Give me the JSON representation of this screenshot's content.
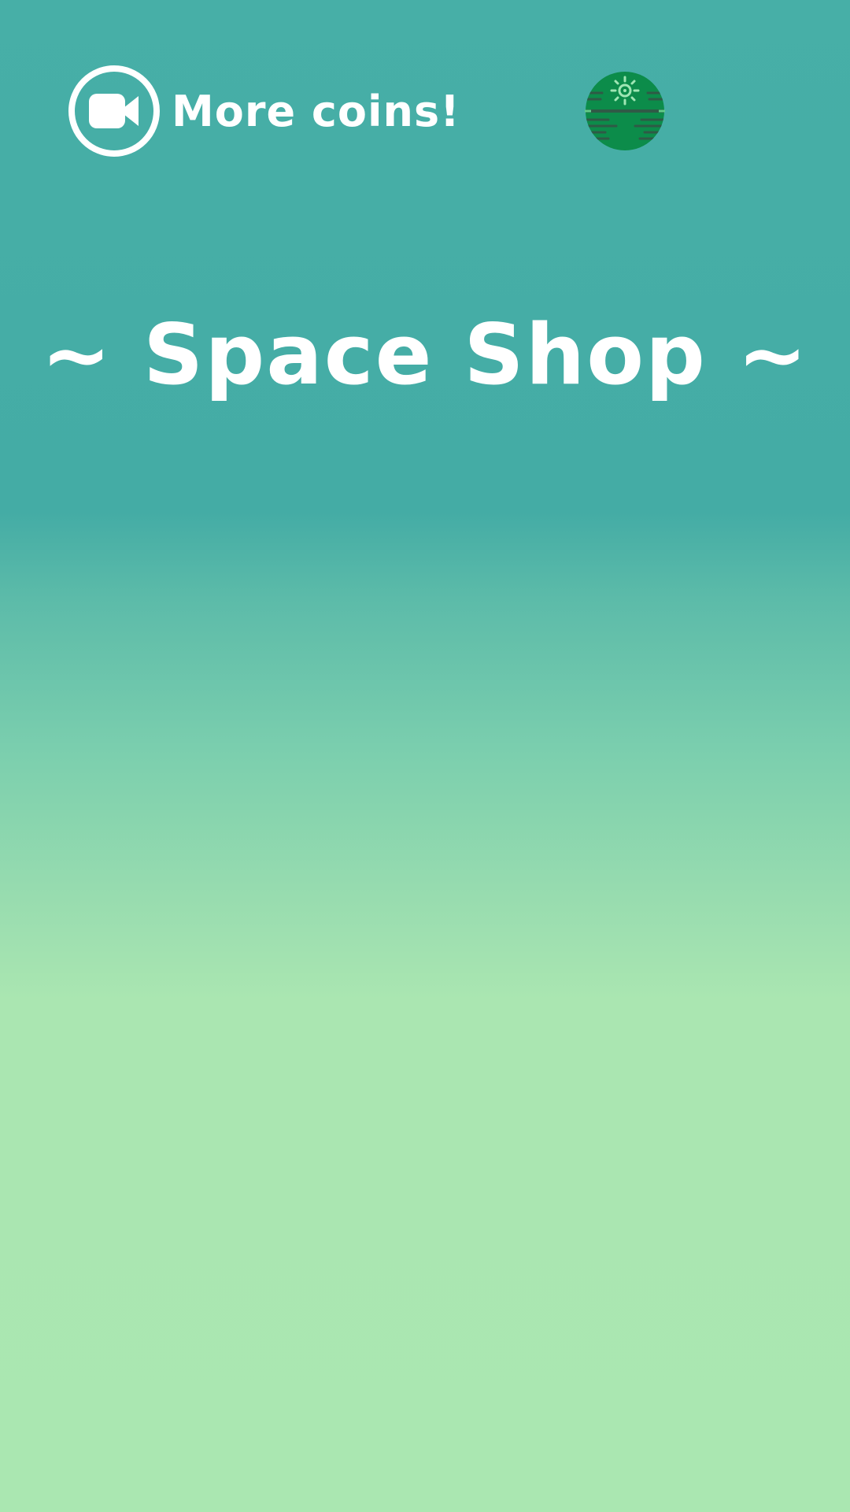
{
  "header": {
    "coins_button_label": "More coins!",
    "coins_button_icon": "video-camera-icon",
    "planet_button_icon": "planet-icon",
    "planet_colors": {
      "body": "#0c8c4a",
      "stripes": "#2f5a46",
      "sun": "#9fe6b4"
    }
  },
  "main": {
    "title": "~ Space Shop ~"
  },
  "theme": {
    "gradient_top": "#47afa7",
    "gradient_bottom": "#aae7b1",
    "text_color": "#ffffff"
  }
}
